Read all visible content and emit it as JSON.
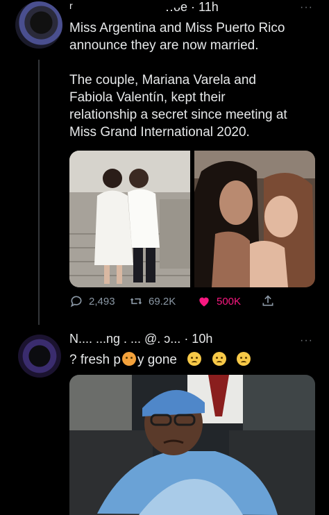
{
  "tweet1": {
    "author_fragment": "r",
    "handle_time": "‥ᴗe · 11h",
    "more": "···",
    "text": "Miss Argentina and Miss Puerto Rico\nannounce they are now married.\n\nThe couple, Mariana Varela and\nFabiola Valentín, kept their\nrelationship a secret since meeting at\nMiss Grand International 2020.",
    "actions": {
      "replies": "2,493",
      "retweets": "69.2K",
      "likes": "500K"
    }
  },
  "tweet2": {
    "header": "N.... ...ng .  ... @. ɔ... · 10h",
    "more": "···",
    "text_start": "? fresh p",
    "text_end": "y gone"
  },
  "colors": {
    "background": "#000000",
    "text": "#e7e9ea",
    "muted": "#8b98a5",
    "like": "#f91880",
    "thread_line": "#333639"
  },
  "icons": [
    "reply-icon",
    "retweet-icon",
    "like-icon",
    "share-icon",
    "cat-emoji",
    "crying-emoji",
    "disappointed-emoji",
    "relieved-emoji"
  ]
}
